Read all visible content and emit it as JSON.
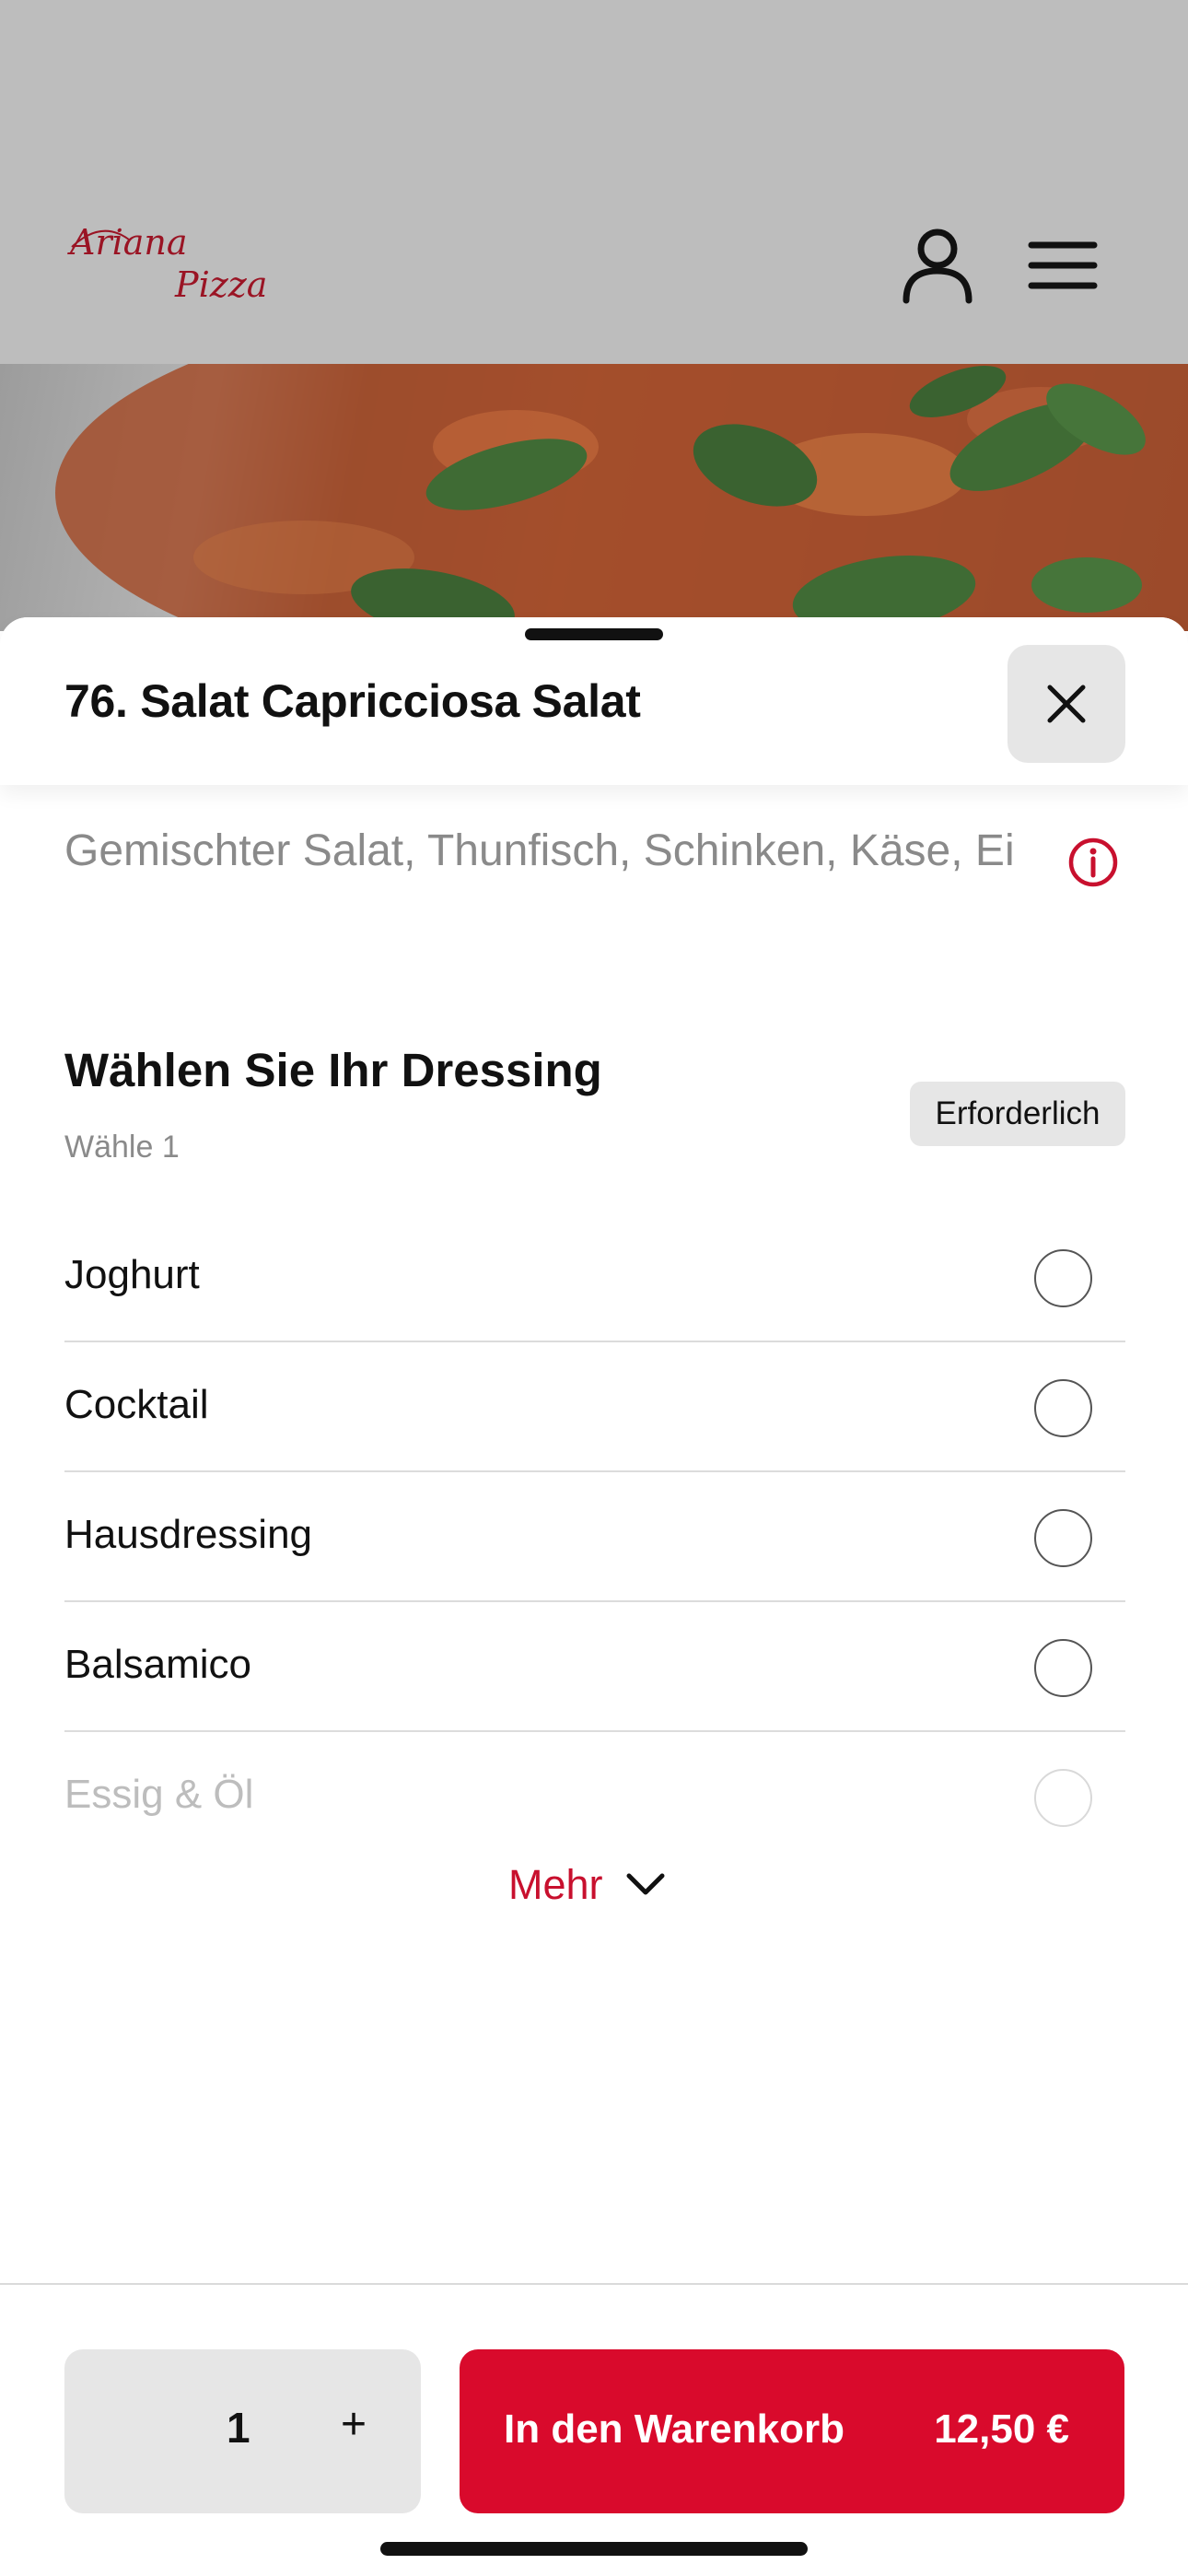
{
  "header": {
    "logo_line1": "Ariana",
    "logo_line2": "Pizza",
    "logo_color": "#c8102e",
    "user_icon": "user-icon",
    "menu_icon": "hamburger-menu-icon"
  },
  "hero": {
    "image": "pizza-photo"
  },
  "sheet": {
    "title": "76. Salat Capricciosa Salat",
    "close_icon": "close-icon",
    "description": "Gemischter Salat, Thunfisch, Schinken, Käse, Ei",
    "info_icon": "info-icon"
  },
  "dressing": {
    "title": "Wählen Sie Ihr Dressing",
    "subtitle": "Wähle 1",
    "required_label": "Erforderlich",
    "options": [
      {
        "label": "Joghurt"
      },
      {
        "label": "Cocktail"
      },
      {
        "label": "Hausdressing"
      },
      {
        "label": "Balsamico"
      },
      {
        "label": "Essig & Öl"
      }
    ],
    "more_label": "Mehr"
  },
  "footer": {
    "quantity": "1",
    "plus_label": "+",
    "add_label": "In den Warenkorb",
    "price": "12,50 €",
    "accent_color": "#d90a2c"
  }
}
